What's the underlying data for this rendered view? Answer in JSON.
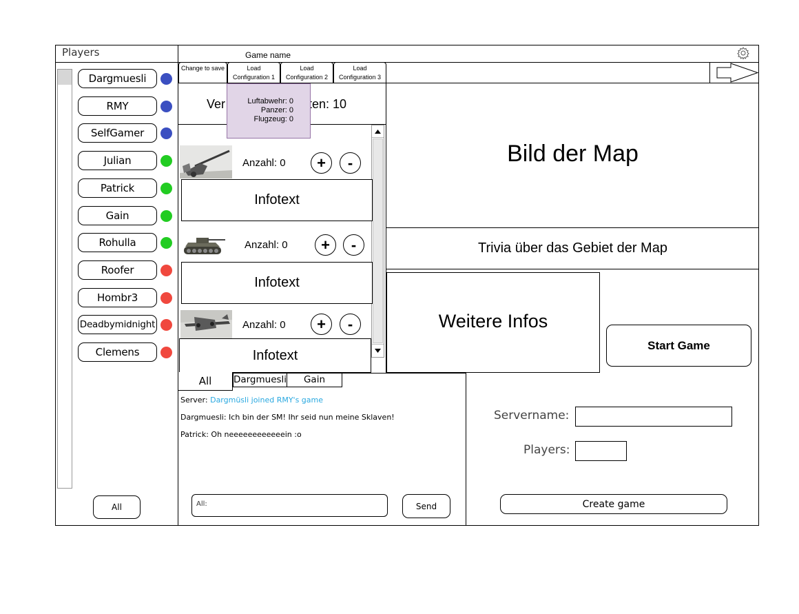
{
  "sidebar": {
    "title": "Players",
    "all_button": "All",
    "players": [
      {
        "name": "Dargmuesli",
        "status": "blue"
      },
      {
        "name": "RMY",
        "status": "blue"
      },
      {
        "name": "SelfGamer",
        "status": "blue"
      },
      {
        "name": "Julian",
        "status": "green"
      },
      {
        "name": "Patrick",
        "status": "green"
      },
      {
        "name": "Gain",
        "status": "green"
      },
      {
        "name": "Rohulla",
        "status": "green"
      },
      {
        "name": "Roofer",
        "status": "red"
      },
      {
        "name": "Hombr3",
        "status": "red"
      },
      {
        "name": "Deadbymidnight",
        "status": "red"
      },
      {
        "name": "Clemens",
        "status": "red"
      }
    ],
    "status_colors": {
      "blue": "#3b4fc1",
      "green": "#22cc22",
      "red": "#f0483e"
    }
  },
  "header": {
    "game_name_label": "Game name",
    "settings_icon": "gear-icon",
    "tabs": [
      {
        "label": "Change to save"
      },
      {
        "label": "Load Configuration 1"
      },
      {
        "label": "Load Configuration 2"
      },
      {
        "label": "Load Configuration 3"
      }
    ],
    "next_icon": "arrow-right-icon"
  },
  "units": {
    "header_left": "Ver",
    "header_right": "eiten: 10",
    "tooltip": {
      "lines": [
        "Luftabwehr: 0",
        "Panzer: 0",
        "Flugzeug: 0"
      ],
      "background": "#e1d5e7"
    },
    "items": [
      {
        "image": "flak-gun-image",
        "count_label": "Anzahl: 0",
        "plus": "+",
        "minus": "-",
        "info": "Infotext"
      },
      {
        "image": "tank-image",
        "count_label": "Anzahl: 0",
        "plus": "+",
        "minus": "-",
        "info": "Infotext"
      },
      {
        "image": "bomber-plane-image",
        "count_label": "Anzahl: 0",
        "plus": "+",
        "minus": "-",
        "info": "Infotext"
      }
    ]
  },
  "map": {
    "image_label": "Bild der Map",
    "trivia": "Trivia über das Gebiet der Map",
    "more_info": "Weitere Infos",
    "start_button": "Start Game"
  },
  "chat": {
    "tabs": [
      "All",
      "Dargmuesli",
      "Gain"
    ],
    "messages": [
      {
        "sender": "Server:",
        "text": "Dargmüsli joined RMY's game",
        "color": "#29a8e0"
      },
      {
        "sender": "Dargmuesli:",
        "text": "Ich bin der SM! Ihr seid nun meine Sklaven!",
        "color": "#000000"
      },
      {
        "sender": "Patrick:",
        "text": "Oh neeeeeeeeeeeein :o",
        "color": "#000000"
      }
    ],
    "input_value": "All:",
    "send_button": "Send"
  },
  "server": {
    "servername_label": "Servername:",
    "servername_value": "",
    "players_label": "Players:",
    "players_value": "",
    "create_button": "Create game"
  }
}
